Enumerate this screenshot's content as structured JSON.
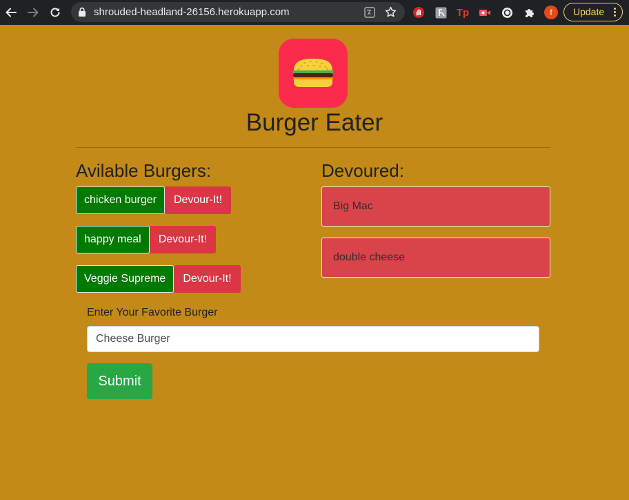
{
  "browser": {
    "url": "shrouded-headland-26156.herokuapp.com",
    "update_label": "Update",
    "profile_initial": "f",
    "extensions": [
      "stop-hand-icon",
      "font-extension-icon",
      "tp-extension-icon",
      "video-record-icon",
      "circle-extension-icon",
      "puzzle-icon"
    ],
    "ext_tp_text": "Tp"
  },
  "page": {
    "title": "Burger Eater",
    "logo_icon": "burger-icon",
    "background_color": "#c38a18"
  },
  "available": {
    "heading": "Avilable Burgers:",
    "action_label": "Devour-It!",
    "burgers": [
      {
        "name": "chicken burger"
      },
      {
        "name": "happy meal"
      },
      {
        "name": "Veggie Supreme"
      }
    ]
  },
  "devoured": {
    "heading": "Devoured:",
    "items": [
      {
        "name": "Big Mac"
      },
      {
        "name": "double cheese"
      }
    ]
  },
  "form": {
    "label": "Enter Your Favorite Burger",
    "input_value": "Cheese Burger",
    "submit_label": "Submit"
  },
  "colors": {
    "available_item": "#007a00",
    "devour_button": "#dc3545",
    "devoured_item": "#d9444a",
    "submit_button": "#28a745",
    "logo_background": "#fc2a4d"
  }
}
